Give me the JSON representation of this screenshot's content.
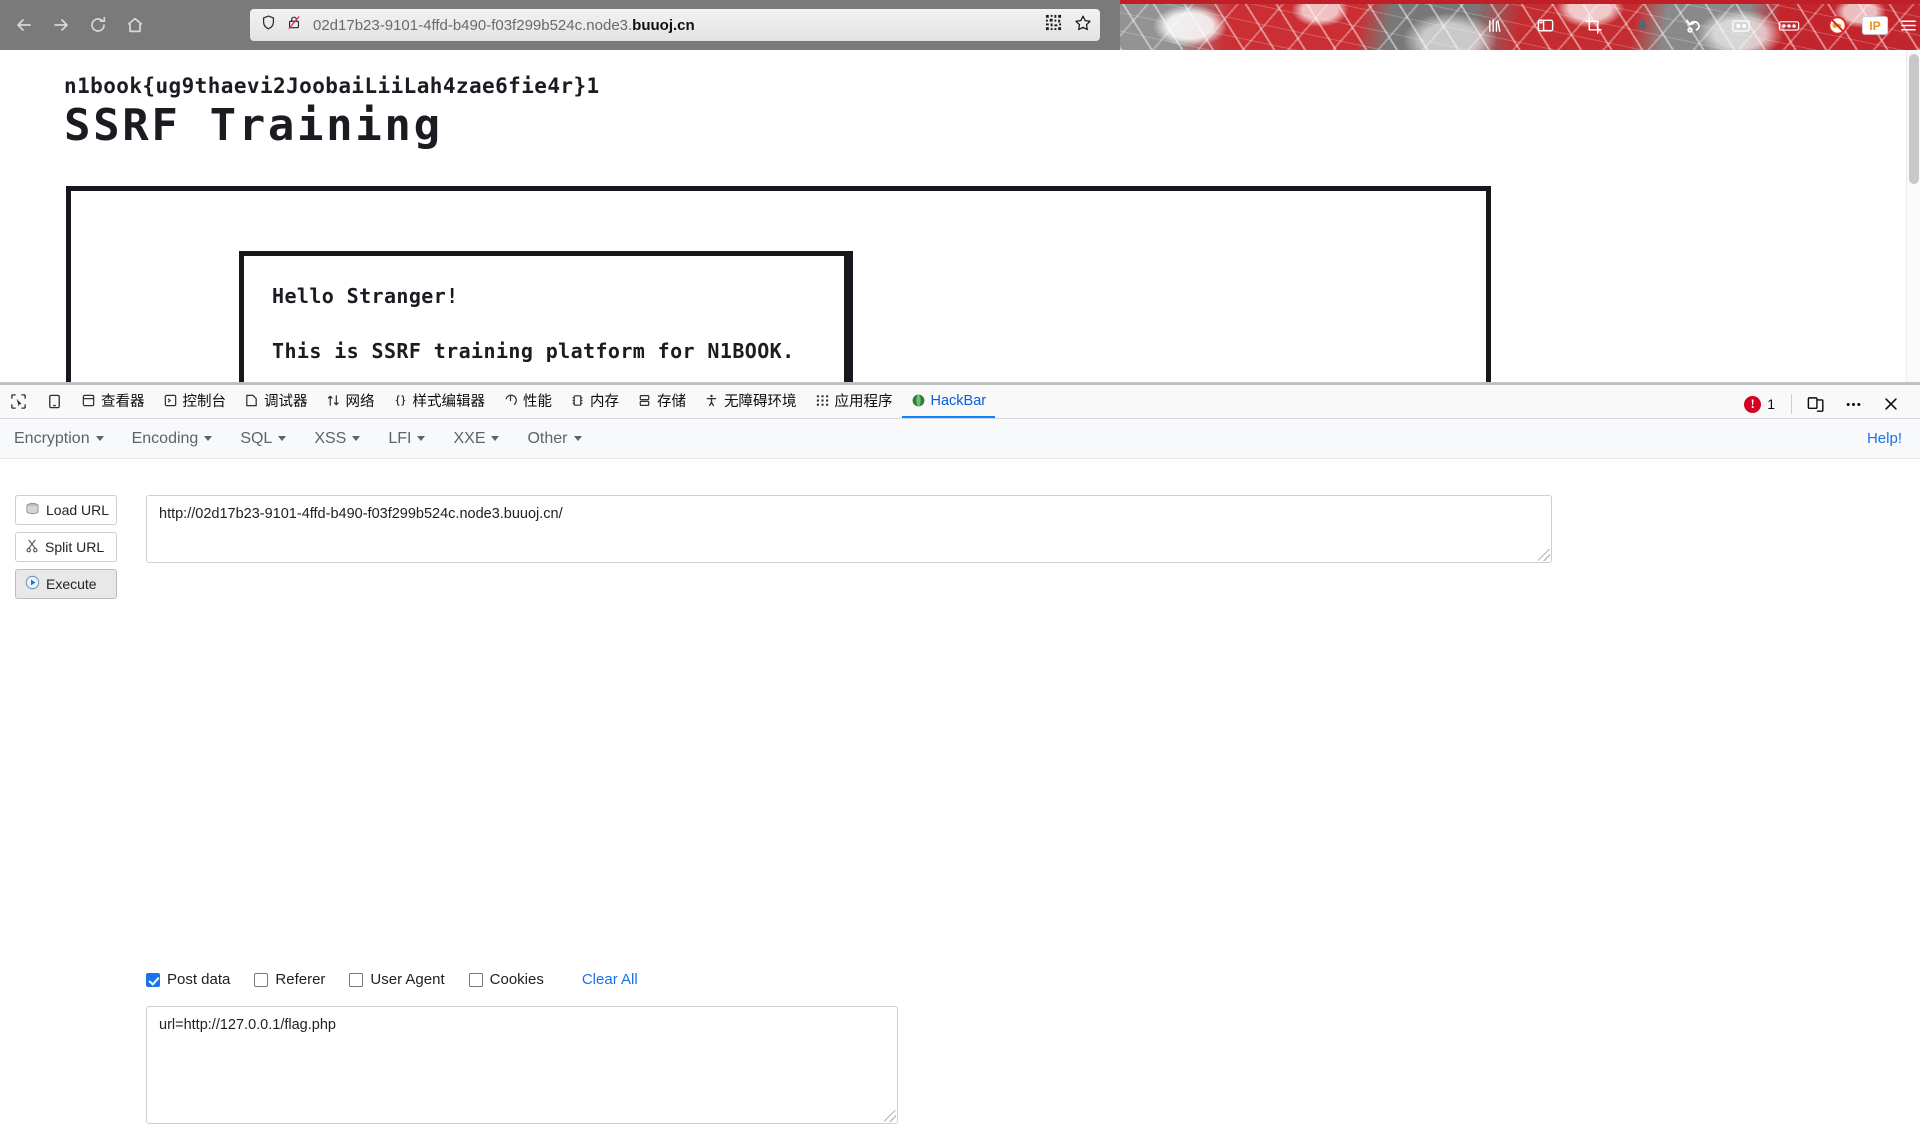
{
  "browser": {
    "nav": {
      "back_label": "Back",
      "forward_label": "Forward",
      "reload_label": "Reload",
      "home_label": "Home"
    },
    "urlbar": {
      "prefix": "02d17b23-9101-4ffd-b490-f03f299b524c.node3.",
      "domain": "buuoj.cn",
      "full_url": "02d17b23-9101-4ffd-b490-f03f299b524c.node3.buuoj.cn",
      "shield_icon": "shield-icon",
      "insecure_lock_icon": "lock-crossed-icon",
      "qr_icon": "qr-code-icon",
      "bookmark_icon": "star-icon"
    },
    "extensions": [
      {
        "name": "library-icon"
      },
      {
        "name": "sidebar-icon"
      },
      {
        "name": "screenshot-crop-icon"
      },
      {
        "name": "droplet-icon"
      },
      {
        "name": "undo-arrow-icon"
      },
      {
        "name": "containers-icon"
      },
      {
        "name": "cookies-icon"
      },
      {
        "name": "blocked-icon"
      },
      {
        "name": "ip-icon",
        "label": "IP"
      },
      {
        "name": "app-menu-icon"
      }
    ]
  },
  "page": {
    "flag": "n1book{ug9thaevi2JoobaiLiiLah4zae6fie4r}1",
    "title": "SSRF Training",
    "greeting": "Hello Stranger!",
    "description": "This is SSRF training platform for N1BOOK."
  },
  "devtools": {
    "picker_icon": "element-picker-icon",
    "responsive_icon": "responsive-design-icon",
    "tabs": [
      {
        "label": "查看器",
        "icon": "inspector-icon",
        "active": false
      },
      {
        "label": "控制台",
        "icon": "console-icon",
        "active": false
      },
      {
        "label": "调试器",
        "icon": "debugger-icon",
        "active": false
      },
      {
        "label": "网络",
        "icon": "network-icon",
        "active": false
      },
      {
        "label": "样式编辑器",
        "icon": "style-editor-icon",
        "active": false
      },
      {
        "label": "性能",
        "icon": "performance-icon",
        "active": false
      },
      {
        "label": "内存",
        "icon": "memory-icon",
        "active": false
      },
      {
        "label": "存储",
        "icon": "storage-icon",
        "active": false
      },
      {
        "label": "无障碍环境",
        "icon": "accessibility-icon",
        "active": false
      },
      {
        "label": "应用程序",
        "icon": "application-icon",
        "active": false
      },
      {
        "label": "HackBar",
        "icon": "hackbar-icon",
        "active": true
      }
    ],
    "error_count": "1",
    "error_icon": "error-circle-icon",
    "dock_icon": "dock-layout-icon",
    "more_icon": "more-options-icon",
    "close_icon": "close-icon",
    "accent_color": "#0a84ff",
    "error_color": "#d70022"
  },
  "hackbar": {
    "menus": [
      {
        "label": "Encryption"
      },
      {
        "label": "Encoding"
      },
      {
        "label": "SQL"
      },
      {
        "label": "XSS"
      },
      {
        "label": "LFI"
      },
      {
        "label": "XXE"
      },
      {
        "label": "Other"
      }
    ],
    "help_label": "Help!",
    "buttons": [
      {
        "label": "Load URL",
        "icon": "disk-icon",
        "pressed": false
      },
      {
        "label": "Split URL",
        "icon": "scissors-icon",
        "pressed": false
      },
      {
        "label": "Execute",
        "icon": "play-icon",
        "pressed": true
      }
    ],
    "url_value": "http://02d17b23-9101-4ffd-b490-f03f299b524c.node3.buuoj.cn/",
    "url_placeholder": "",
    "checkboxes": [
      {
        "label": "Post data",
        "checked": true
      },
      {
        "label": "Referer",
        "checked": false
      },
      {
        "label": "User Agent",
        "checked": false
      },
      {
        "label": "Cookies",
        "checked": false
      }
    ],
    "clear_all_label": "Clear All",
    "post_data_value": "url=http://127.0.0.1/flag.php",
    "post_data_placeholder": "",
    "link_color": "#1a73e8"
  }
}
